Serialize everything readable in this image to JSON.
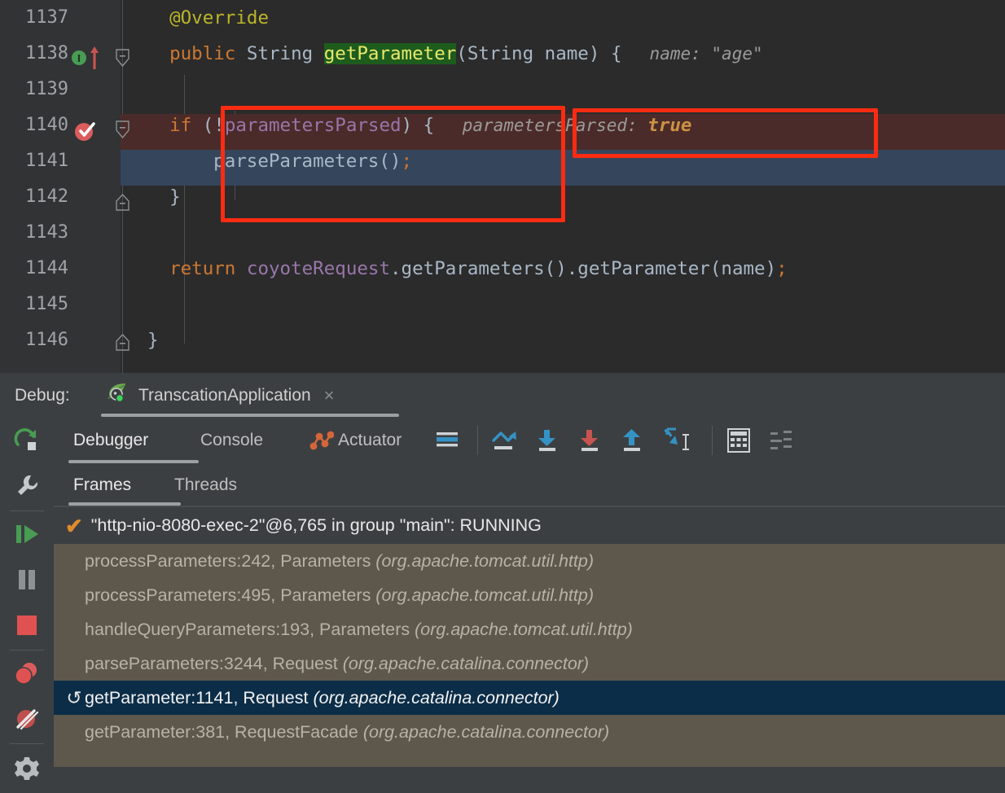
{
  "editor": {
    "lines": [
      {
        "num": "1137",
        "indent": 4,
        "tokens": [
          {
            "t": "@Override",
            "c": "tok-ann"
          }
        ]
      },
      {
        "num": "1138",
        "indent": 4,
        "tokens": [
          {
            "t": "public ",
            "c": "tok-kw"
          },
          {
            "t": "String ",
            "c": "tok-type"
          },
          {
            "t": "getParameter",
            "c": "tok-search-hl"
          },
          {
            "t": "(String name) {",
            "c": "tok-punct"
          }
        ],
        "hint": "name:",
        "hint_value": "\"age\"",
        "hint_value_class": "hint"
      },
      {
        "num": "1139",
        "indent": 4,
        "tokens": []
      },
      {
        "num": "1140",
        "indent": 4,
        "tokens": [
          {
            "t": "if",
            "c": "tok-kw"
          },
          {
            "t": " (!",
            "c": "tok-punct"
          },
          {
            "t": "parametersParsed",
            "c": "tok-field"
          },
          {
            "t": ") {",
            "c": "tok-punct"
          }
        ],
        "hint": "parametersParsed:",
        "hint_value": "true",
        "hint_value_class": "hint-val"
      },
      {
        "num": "1141",
        "indent": 8,
        "tokens": [
          {
            "t": "parseParameters",
            "c": "tok-mcall"
          },
          {
            "t": "()",
            "c": "tok-punct"
          },
          {
            "t": ";",
            "c": "tok-semi"
          }
        ]
      },
      {
        "num": "1142",
        "indent": 4,
        "tokens": [
          {
            "t": "}",
            "c": "tok-punct"
          }
        ]
      },
      {
        "num": "1143",
        "indent": 4,
        "tokens": []
      },
      {
        "num": "1144",
        "indent": 4,
        "tokens": [
          {
            "t": "return ",
            "c": "tok-kw"
          },
          {
            "t": "coyoteRequest",
            "c": "tok-field"
          },
          {
            "t": ".getParameters().getParameter(name)",
            "c": "tok-punct"
          },
          {
            "t": ";",
            "c": "tok-semi"
          }
        ]
      },
      {
        "num": "1145",
        "indent": 4,
        "tokens": []
      },
      {
        "num": "1146",
        "indent": 2,
        "tokens": [
          {
            "t": "}",
            "c": "tok-punct"
          }
        ]
      }
    ],
    "gutter_icons": {
      "override_marker": "implemented-method-icon",
      "override_arrow": "overriding-method-arrow-icon",
      "breakpoint": "breakpoint-verified-icon"
    },
    "annotation_boxes": [
      {
        "name": "code-block-highlight-box"
      },
      {
        "name": "inline-value-highlight-box"
      }
    ],
    "colors": {
      "background": "#2b2b2b",
      "gutter": "#313335",
      "breakpoint_line": "#4b2b29",
      "execution_line": "#35465c",
      "search_highlight": "#1d5c1d",
      "annotation_red": "#fb2c12"
    }
  },
  "debug_window": {
    "title": "Debug:",
    "run_configuration": "TranscationApplication",
    "run_config_icon": "spring-boot-leaf-icon",
    "close_tab_glyph": "×",
    "sidebar": [
      {
        "name": "rerun-button",
        "icon": "rerun-icon"
      },
      {
        "name": "edit-configurations-button",
        "icon": "wrench-icon"
      },
      {
        "name": "resume-program-button",
        "icon": "resume-play-icon"
      },
      {
        "name": "pause-program-button",
        "icon": "pause-icon"
      },
      {
        "name": "stop-button",
        "icon": "stop-square-icon"
      },
      {
        "name": "view-breakpoints-button",
        "icon": "breakpoints-icon"
      },
      {
        "name": "mute-breakpoints-button",
        "icon": "mute-breakpoints-icon"
      },
      {
        "name": "settings-button",
        "icon": "gear-icon"
      }
    ],
    "tabs": [
      {
        "label": "Debugger",
        "active": true
      },
      {
        "label": "Console",
        "active": false
      },
      {
        "label": "Actuator",
        "active": false,
        "icon": "actuator-icon"
      }
    ],
    "toolbar": [
      {
        "name": "layout-settings-button",
        "icon": "layout-lines-icon"
      },
      {
        "name": "show-execution-point-button",
        "icon": "show-execution-point-icon"
      },
      {
        "name": "step-over-button",
        "icon": "step-over-icon"
      },
      {
        "name": "step-into-button",
        "icon": "step-into-icon"
      },
      {
        "name": "step-out-button",
        "icon": "step-out-icon"
      },
      {
        "name": "force-step-into-button",
        "icon": "force-step-into-icon"
      },
      {
        "name": "evaluate-expression-button",
        "icon": "calculator-icon"
      },
      {
        "name": "trace-settings-button",
        "icon": "trace-icon"
      }
    ],
    "sub_tabs": [
      {
        "label": "Frames",
        "active": true
      },
      {
        "label": "Threads",
        "active": false
      }
    ],
    "thread": {
      "check_glyph": "✔",
      "text": "\"http-nio-8080-exec-2\"@6,765 in group \"main\": RUNNING"
    },
    "frames": [
      {
        "method": "processParameters:242, Parameters",
        "package": "(org.apache.tomcat.util.http)",
        "selected": false
      },
      {
        "method": "processParameters:495, Parameters",
        "package": "(org.apache.tomcat.util.http)",
        "selected": false
      },
      {
        "method": "handleQueryParameters:193, Parameters",
        "package": "(org.apache.tomcat.util.http)",
        "selected": false
      },
      {
        "method": "parseParameters:3244, Request",
        "package": "(org.apache.catalina.connector)",
        "selected": false
      },
      {
        "method": "getParameter:1141, Request",
        "package": "(org.apache.catalina.connector)",
        "selected": true,
        "arrow": "↺"
      },
      {
        "method": "getParameter:381, RequestFacade",
        "package": "(org.apache.catalina.connector)",
        "selected": false
      }
    ],
    "colors": {
      "panel": "#3c3f41",
      "frames_background": "#5d584b",
      "selected_frame": "#0c2d48",
      "thread_row": "#3c3f41"
    }
  }
}
